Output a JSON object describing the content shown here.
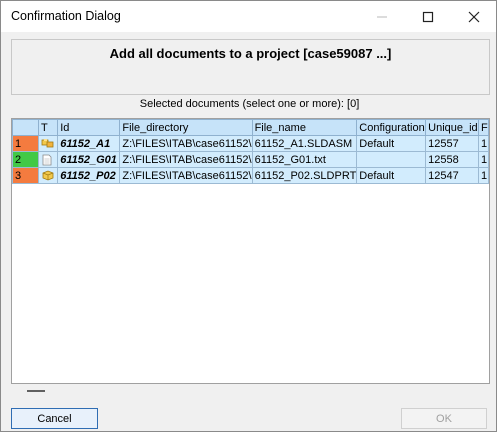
{
  "window": {
    "title": "Confirmation Dialog"
  },
  "header": {
    "title": "Add all documents to a project [case59087 ...]"
  },
  "selection": {
    "label": "Selected documents (select one or more): [0]"
  },
  "table": {
    "columns": [
      "T",
      "Id",
      "File_directory",
      "File_name",
      "Configuration",
      "Unique_id",
      "F"
    ],
    "rows": [
      {
        "num": "1",
        "color": "#f47b3f",
        "icon": "assembly-icon",
        "id": "61152_A1",
        "dir": "Z:\\FILES\\ITAB\\case61152\\",
        "file": "61152_A1.SLDASM",
        "config": "Default",
        "uid": "12557",
        "extra": "1"
      },
      {
        "num": "2",
        "color": "#42c946",
        "icon": "text-file-icon",
        "id": "61152_G01",
        "dir": "Z:\\FILES\\ITAB\\case61152\\",
        "file": "61152_G01.txt",
        "config": "",
        "uid": "12558",
        "extra": "1"
      },
      {
        "num": "3",
        "color": "#f47b3f",
        "icon": "part-icon",
        "id": "61152_P02",
        "dir": "Z:\\FILES\\ITAB\\case61152\\",
        "file": "61152_P02.SLDPRT",
        "config": "Default",
        "uid": "12547",
        "extra": "1"
      }
    ]
  },
  "buttons": {
    "cancel": "Cancel",
    "ok": "OK"
  }
}
